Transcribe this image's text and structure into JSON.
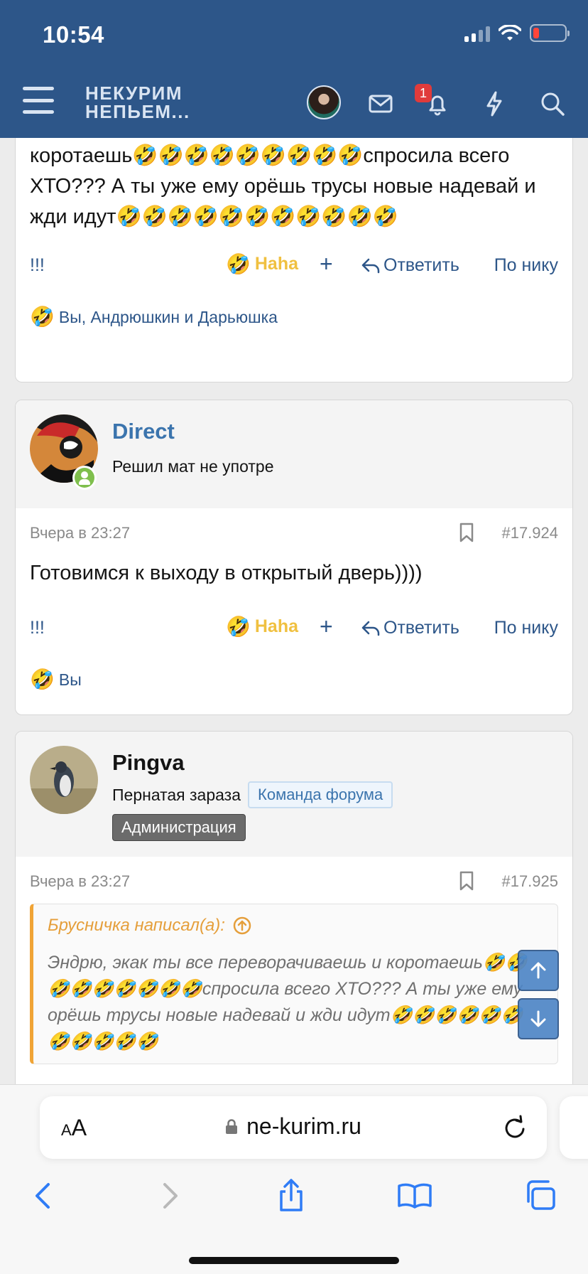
{
  "status": {
    "time": "10:54"
  },
  "header": {
    "logo_line1": "НЕКУРИМ",
    "logo_line2": "НЕПЬЕМ...",
    "notification_count": "1"
  },
  "posts": [
    {
      "body": "коротаешь🤣🤣🤣🤣🤣🤣🤣🤣🤣спросила всего ХТО??? А ты уже ему орёшь трусы новые надевай и жди идут🤣🤣🤣🤣🤣🤣🤣🤣🤣🤣🤣",
      "actions": {
        "bang": "!!!",
        "haha": "Haha",
        "plus": "+",
        "reply": "Ответить",
        "bynick": "По нику"
      },
      "reactions": "Вы, Андрюшкин и Дарьюшка"
    },
    {
      "author": "Direct",
      "user_title": "Решил мат не употре",
      "date": "Вчера в 23:27",
      "number": "#17.924",
      "body": "Готовимся к выходу в открытый дверь))))",
      "actions": {
        "bang": "!!!",
        "haha": "Haha",
        "plus": "+",
        "reply": "Ответить",
        "bynick": "По нику"
      },
      "reactions": "Вы"
    },
    {
      "author": "Pingva",
      "user_title": "Пернатая зараза",
      "badge_team": "Команда форума",
      "badge_admin": "Администрация",
      "date": "Вчера в 23:27",
      "number": "#17.925",
      "quote_author": "Брусничка написал(а):",
      "quote_text": "Эндрю, экак ты все переворачиваешь и коротаешь🤣🤣🤣🤣🤣🤣🤣🤣🤣спросила всего ХТО??? А ты уже ему орёшь трусы новые надевай и жди идут🤣🤣🤣🤣🤣🤣🤣🤣🤣🤣🤣"
    }
  ],
  "browser": {
    "aa_small": "A",
    "aa_large": "A",
    "url": "ne-kurim.ru"
  },
  "colors": {
    "header": "#2d5689",
    "link": "#2d5689",
    "haha": "#f0c040",
    "quote_accent": "#f0a436",
    "online": "#7fbf4d"
  }
}
